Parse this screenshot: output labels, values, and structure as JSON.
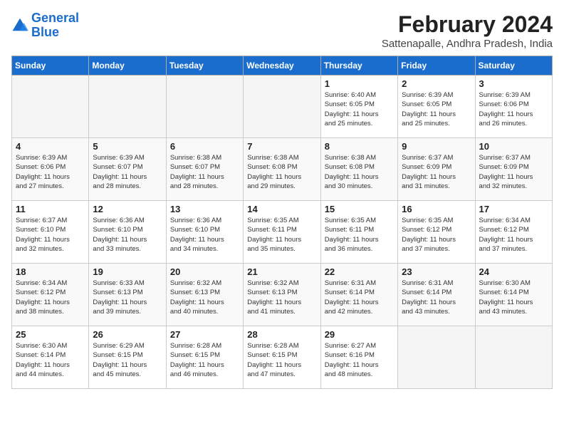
{
  "logo": {
    "line1": "General",
    "line2": "Blue"
  },
  "title": "February 2024",
  "location": "Sattenapalle, Andhra Pradesh, India",
  "days_of_week": [
    "Sunday",
    "Monday",
    "Tuesday",
    "Wednesday",
    "Thursday",
    "Friday",
    "Saturday"
  ],
  "weeks": [
    [
      {
        "day": "",
        "info": ""
      },
      {
        "day": "",
        "info": ""
      },
      {
        "day": "",
        "info": ""
      },
      {
        "day": "",
        "info": ""
      },
      {
        "day": "1",
        "info": "Sunrise: 6:40 AM\nSunset: 6:05 PM\nDaylight: 11 hours\nand 25 minutes."
      },
      {
        "day": "2",
        "info": "Sunrise: 6:39 AM\nSunset: 6:05 PM\nDaylight: 11 hours\nand 25 minutes."
      },
      {
        "day": "3",
        "info": "Sunrise: 6:39 AM\nSunset: 6:06 PM\nDaylight: 11 hours\nand 26 minutes."
      }
    ],
    [
      {
        "day": "4",
        "info": "Sunrise: 6:39 AM\nSunset: 6:06 PM\nDaylight: 11 hours\nand 27 minutes."
      },
      {
        "day": "5",
        "info": "Sunrise: 6:39 AM\nSunset: 6:07 PM\nDaylight: 11 hours\nand 28 minutes."
      },
      {
        "day": "6",
        "info": "Sunrise: 6:38 AM\nSunset: 6:07 PM\nDaylight: 11 hours\nand 28 minutes."
      },
      {
        "day": "7",
        "info": "Sunrise: 6:38 AM\nSunset: 6:08 PM\nDaylight: 11 hours\nand 29 minutes."
      },
      {
        "day": "8",
        "info": "Sunrise: 6:38 AM\nSunset: 6:08 PM\nDaylight: 11 hours\nand 30 minutes."
      },
      {
        "day": "9",
        "info": "Sunrise: 6:37 AM\nSunset: 6:09 PM\nDaylight: 11 hours\nand 31 minutes."
      },
      {
        "day": "10",
        "info": "Sunrise: 6:37 AM\nSunset: 6:09 PM\nDaylight: 11 hours\nand 32 minutes."
      }
    ],
    [
      {
        "day": "11",
        "info": "Sunrise: 6:37 AM\nSunset: 6:10 PM\nDaylight: 11 hours\nand 32 minutes."
      },
      {
        "day": "12",
        "info": "Sunrise: 6:36 AM\nSunset: 6:10 PM\nDaylight: 11 hours\nand 33 minutes."
      },
      {
        "day": "13",
        "info": "Sunrise: 6:36 AM\nSunset: 6:10 PM\nDaylight: 11 hours\nand 34 minutes."
      },
      {
        "day": "14",
        "info": "Sunrise: 6:35 AM\nSunset: 6:11 PM\nDaylight: 11 hours\nand 35 minutes."
      },
      {
        "day": "15",
        "info": "Sunrise: 6:35 AM\nSunset: 6:11 PM\nDaylight: 11 hours\nand 36 minutes."
      },
      {
        "day": "16",
        "info": "Sunrise: 6:35 AM\nSunset: 6:12 PM\nDaylight: 11 hours\nand 37 minutes."
      },
      {
        "day": "17",
        "info": "Sunrise: 6:34 AM\nSunset: 6:12 PM\nDaylight: 11 hours\nand 37 minutes."
      }
    ],
    [
      {
        "day": "18",
        "info": "Sunrise: 6:34 AM\nSunset: 6:12 PM\nDaylight: 11 hours\nand 38 minutes."
      },
      {
        "day": "19",
        "info": "Sunrise: 6:33 AM\nSunset: 6:13 PM\nDaylight: 11 hours\nand 39 minutes."
      },
      {
        "day": "20",
        "info": "Sunrise: 6:32 AM\nSunset: 6:13 PM\nDaylight: 11 hours\nand 40 minutes."
      },
      {
        "day": "21",
        "info": "Sunrise: 6:32 AM\nSunset: 6:13 PM\nDaylight: 11 hours\nand 41 minutes."
      },
      {
        "day": "22",
        "info": "Sunrise: 6:31 AM\nSunset: 6:14 PM\nDaylight: 11 hours\nand 42 minutes."
      },
      {
        "day": "23",
        "info": "Sunrise: 6:31 AM\nSunset: 6:14 PM\nDaylight: 11 hours\nand 43 minutes."
      },
      {
        "day": "24",
        "info": "Sunrise: 6:30 AM\nSunset: 6:14 PM\nDaylight: 11 hours\nand 43 minutes."
      }
    ],
    [
      {
        "day": "25",
        "info": "Sunrise: 6:30 AM\nSunset: 6:14 PM\nDaylight: 11 hours\nand 44 minutes."
      },
      {
        "day": "26",
        "info": "Sunrise: 6:29 AM\nSunset: 6:15 PM\nDaylight: 11 hours\nand 45 minutes."
      },
      {
        "day": "27",
        "info": "Sunrise: 6:28 AM\nSunset: 6:15 PM\nDaylight: 11 hours\nand 46 minutes."
      },
      {
        "day": "28",
        "info": "Sunrise: 6:28 AM\nSunset: 6:15 PM\nDaylight: 11 hours\nand 47 minutes."
      },
      {
        "day": "29",
        "info": "Sunrise: 6:27 AM\nSunset: 6:16 PM\nDaylight: 11 hours\nand 48 minutes."
      },
      {
        "day": "",
        "info": ""
      },
      {
        "day": "",
        "info": ""
      }
    ]
  ]
}
